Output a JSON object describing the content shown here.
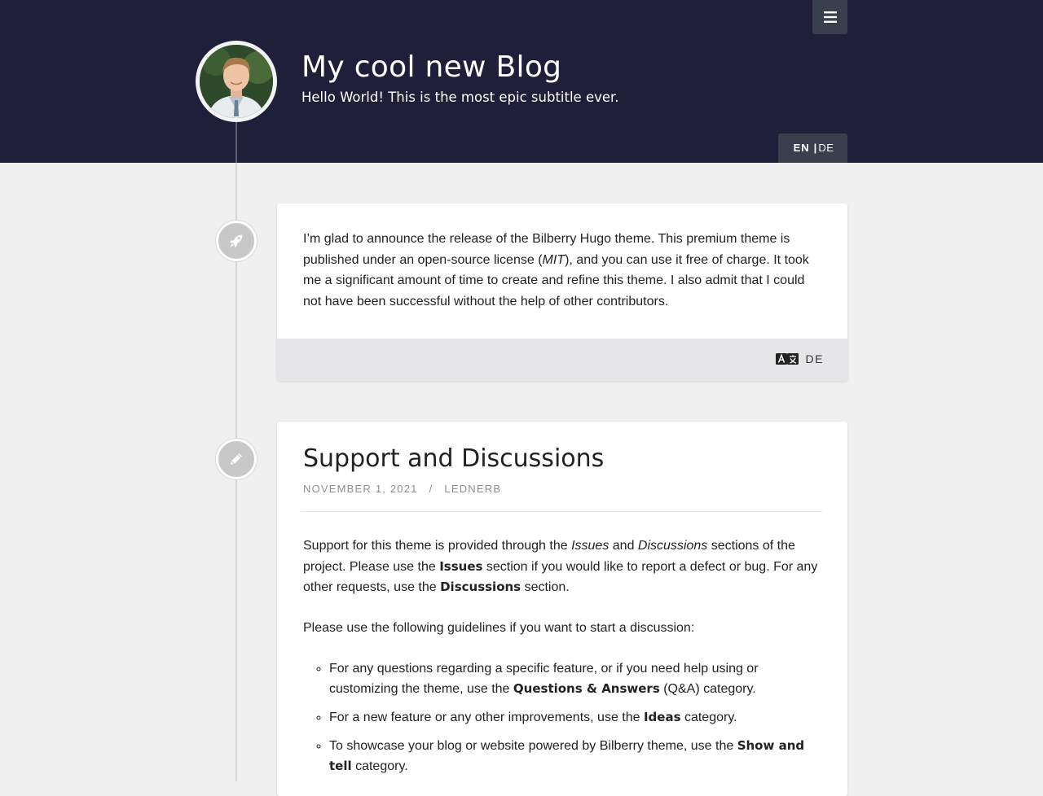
{
  "header": {
    "title": "My cool new Blog",
    "subtitle": "Hello World! This is the most epic subtitle ever.",
    "menu_icon": "hamburger-icon",
    "lang_active": "EN",
    "lang_separator": "|",
    "lang_other": "DE"
  },
  "status_post": {
    "icon": "rocket-icon",
    "text_1": "I’m glad to announce the release of the Bilberry Hugo theme. This premium theme is published under an open-source license (",
    "text_em": "MIT",
    "text_2": "), and you can use it free of charge. It took me a significant amount of time to create and refine this theme. I also admit that I could not have been successful without the help of other contributors.",
    "translation_icon": "translate-icon",
    "translation_label": "DE"
  },
  "article": {
    "icon": "pencil-icon",
    "title": "Support and Discussions",
    "date": "November 1, 2021",
    "slash": "/",
    "author": "lednerb",
    "p1": {
      "a": "Support for this theme is provided through the ",
      "issues_em": "Issues",
      "b": " and ",
      "discussions_em": "Discussions",
      "c": " sections of the project. Please use the ",
      "issues_bold": "Issues",
      "d": " section if you would like to report a defect or bug. For any other requests, use the ",
      "discussions_bold": "Discussions",
      "e": " section."
    },
    "p2": "Please use the following guidelines if you want to start a discussion:",
    "list": [
      {
        "a": "For any questions regarding a specific feature, or if you need help using or customizing the theme, use the ",
        "bold": "Questions & Answers",
        "b": " (Q&A) category."
      },
      {
        "a": "For a new feature or any other improvements, use the ",
        "bold": "Ideas",
        "b": " category."
      },
      {
        "a": "To showcase your blog or website powered by Bilberry theme, use the ",
        "bold": "Show and tell",
        "b": " category."
      }
    ]
  }
}
